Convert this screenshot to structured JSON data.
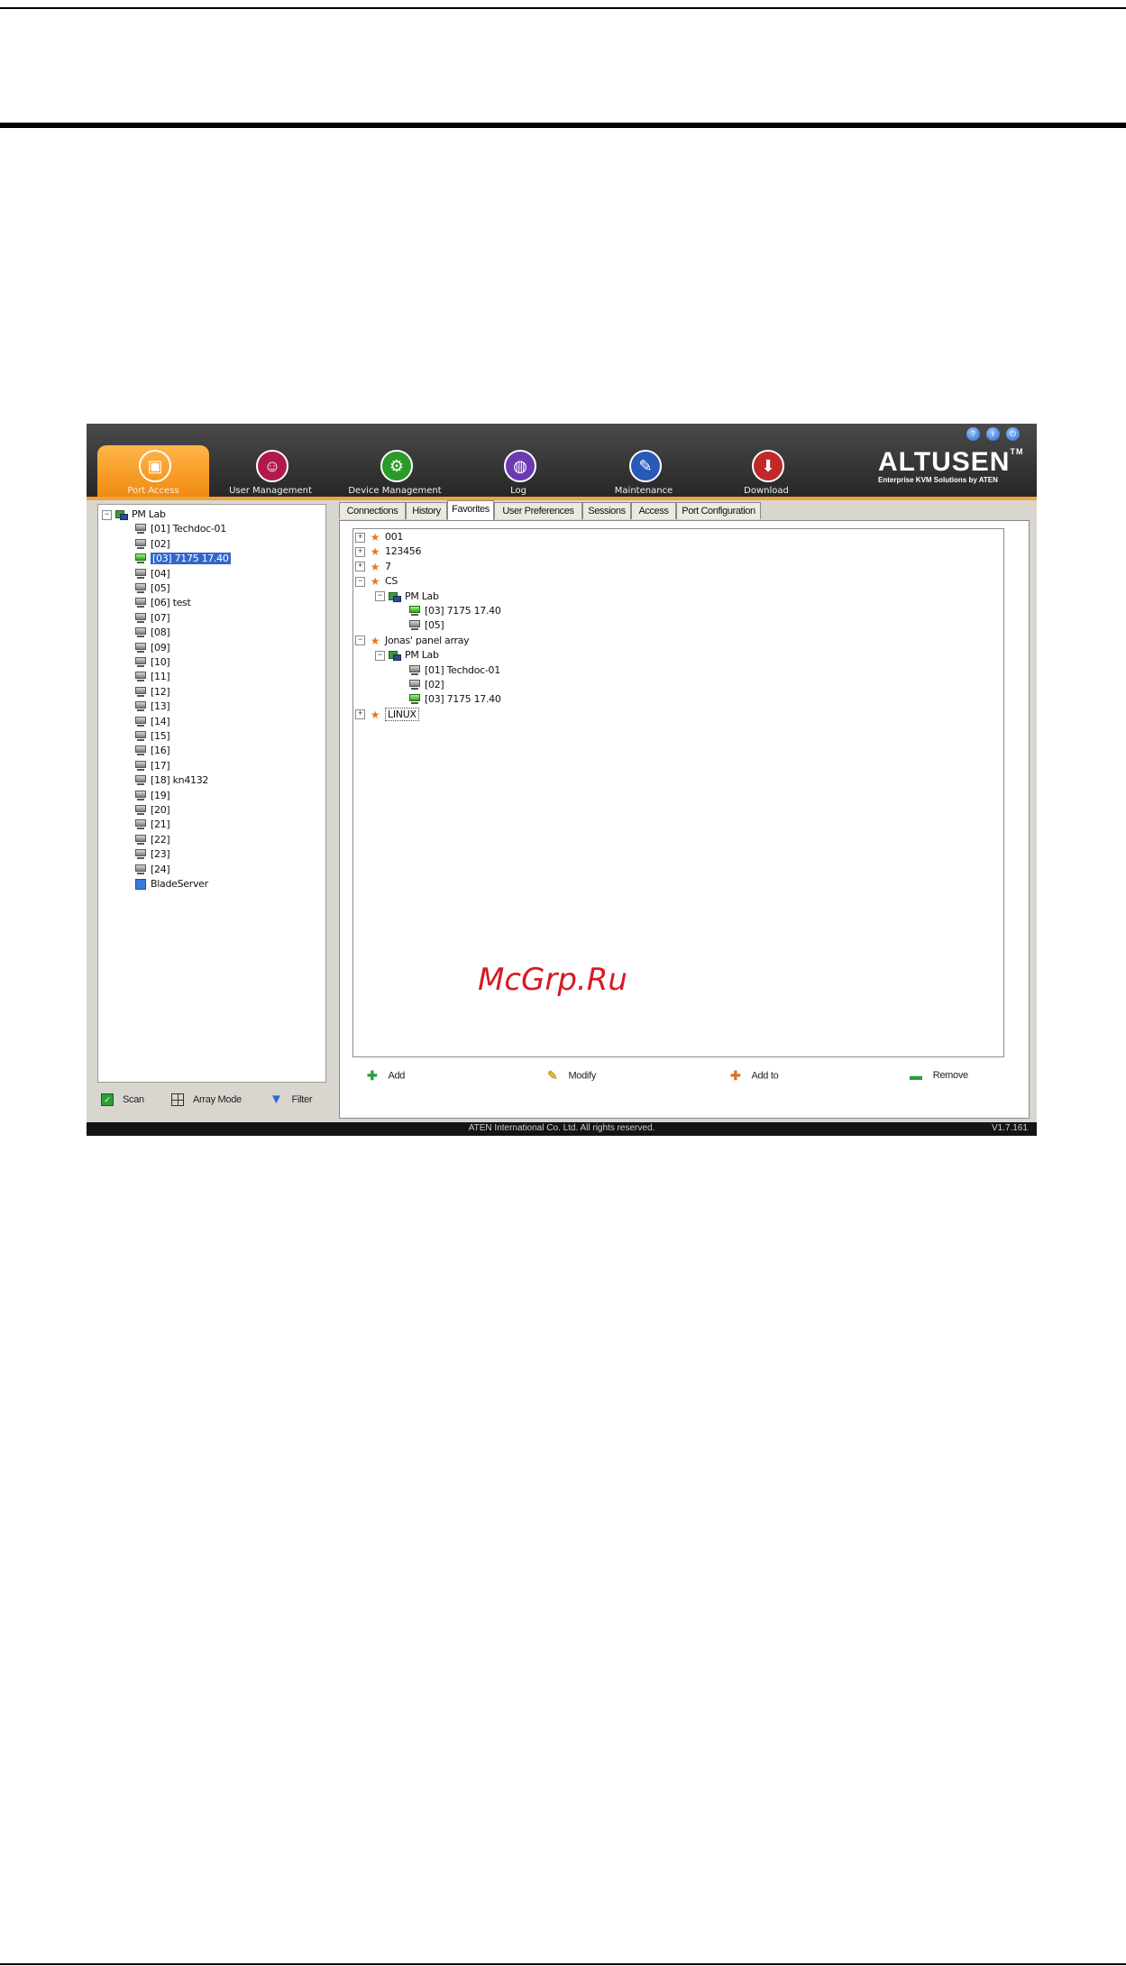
{
  "app": {
    "brand": "ALTUSEN",
    "brand_tm": "TM",
    "brand_tagline": "Enterprise KVM Solutions by ATEN",
    "nav": [
      {
        "label": "Port Access",
        "icon": "port-access-icon",
        "active": true
      },
      {
        "label": "User Management",
        "icon": "user-management-icon"
      },
      {
        "label": "Device Management",
        "icon": "device-management-icon"
      },
      {
        "label": "Log",
        "icon": "log-icon"
      },
      {
        "label": "Maintenance",
        "icon": "maintenance-icon"
      },
      {
        "label": "Download",
        "icon": "download-icon"
      }
    ],
    "accent_color": "#f5a030"
  },
  "left_tree": {
    "root": "PM Lab",
    "ports": [
      "[01] Techdoc-01",
      "[02]",
      "[03] 7175 17.40",
      "[04]",
      "[05]",
      "[06] test",
      "[07]",
      "[08]",
      "[09]",
      "[10]",
      "[11]",
      "[12]",
      "[13]",
      "[14]",
      "[15]",
      "[16]",
      "[17]",
      "[18] kn4132",
      "[19]",
      "[20]",
      "[21]",
      "[22]",
      "[23]",
      "[24]"
    ],
    "blade": "BladeServer",
    "selected": "[03] 7175 17.40"
  },
  "left_toolbar": {
    "scan": "Scan",
    "array_mode": "Array Mode",
    "filter": "Filter"
  },
  "tabs": [
    "Connections",
    "History",
    "Favorites",
    "User Preferences",
    "Sessions",
    "Access",
    "Port Configuration"
  ],
  "active_tab": "Favorites",
  "favorites": {
    "items": [
      {
        "label": "001",
        "level": 0,
        "icon": "star",
        "exp": "+"
      },
      {
        "label": "123456",
        "level": 0,
        "icon": "star",
        "exp": "+"
      },
      {
        "label": "7",
        "level": 0,
        "icon": "star",
        "exp": "+"
      },
      {
        "label": "CS",
        "level": 0,
        "icon": "star",
        "exp": "-"
      },
      {
        "label": "PM Lab",
        "level": 1,
        "icon": "group",
        "exp": "-"
      },
      {
        "label": "[03] 7175 17.40",
        "level": 2,
        "icon": "monitor-on"
      },
      {
        "label": "[05]",
        "level": 2,
        "icon": "monitor"
      },
      {
        "label": "Jonas' panel array",
        "level": 0,
        "icon": "star",
        "exp": "-"
      },
      {
        "label": "PM Lab",
        "level": 1,
        "icon": "group",
        "exp": "-"
      },
      {
        "label": "[01] Techdoc-01",
        "level": 2,
        "icon": "monitor"
      },
      {
        "label": "[02]",
        "level": 2,
        "icon": "monitor"
      },
      {
        "label": "[03] 7175 17.40",
        "level": 2,
        "icon": "monitor-on"
      },
      {
        "label": "LINUX",
        "level": 0,
        "icon": "star",
        "exp": "+",
        "focused": true
      }
    ]
  },
  "actions": {
    "add": "Add",
    "modify": "Modify",
    "add_to": "Add to",
    "remove": "Remove"
  },
  "status": {
    "copyright": "ATEN International Co. Ltd. All rights reserved.",
    "version": "V1.7.161"
  },
  "watermark": "McGrp.Ru"
}
